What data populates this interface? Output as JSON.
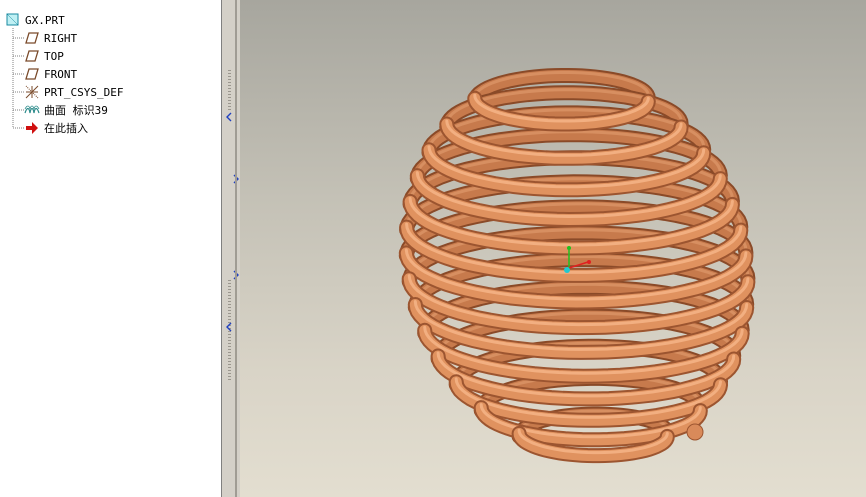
{
  "model_tree": {
    "root": {
      "label": "GX.PRT",
      "icon": "part-icon"
    },
    "items": [
      {
        "label": "RIGHT",
        "icon": "datum-plane-icon"
      },
      {
        "label": "TOP",
        "icon": "datum-plane-icon"
      },
      {
        "label": "FRONT",
        "icon": "datum-plane-icon"
      },
      {
        "label": "PRT_CSYS_DEF",
        "icon": "coordinate-system-icon"
      },
      {
        "label": "曲面 标识39",
        "icon": "surface-icon"
      },
      {
        "label": "在此插入",
        "icon": "insert-here-arrow-icon"
      }
    ]
  },
  "splitter": {
    "icons": [
      "collapse-left-arrow-icon",
      "expand-right-arrow-icon"
    ]
  },
  "viewport": {
    "model": "spiral-coil-sphere",
    "colors": {
      "coil": "#d98a5a",
      "coil_highlight": "#f3b084",
      "coil_shadow": "#9c5530",
      "background_top": "#a7a69e",
      "background_bottom": "#e3ded0"
    },
    "triad_colors": {
      "x": "#e02020",
      "y": "#20c020",
      "z": "#20c8d0"
    }
  }
}
